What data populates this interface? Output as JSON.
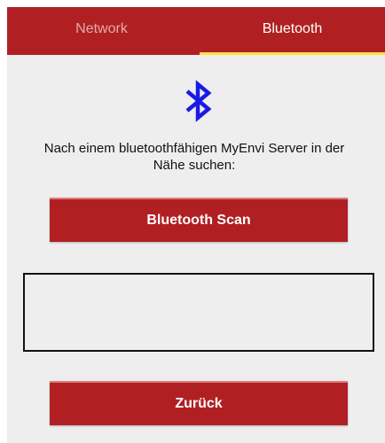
{
  "tabs": [
    {
      "label": "Network",
      "active": false
    },
    {
      "label": "Bluetooth",
      "active": true
    }
  ],
  "icon": "bluetooth-icon",
  "message": {
    "line1": "Nach einem bluetoothfähigen MyEnvi Server in der",
    "line2": "Nähe suchen:"
  },
  "buttons": {
    "scan_label": "Bluetooth Scan",
    "back_label": "Zurück"
  },
  "result_box": {
    "value": ""
  },
  "colors": {
    "primary": "#b02023",
    "tab_indicator": "#ffe14a",
    "inactive_tab_text": "#e6a9aa",
    "background": "#eeeeee",
    "bluetooth_icon": "#1a1ae6"
  }
}
